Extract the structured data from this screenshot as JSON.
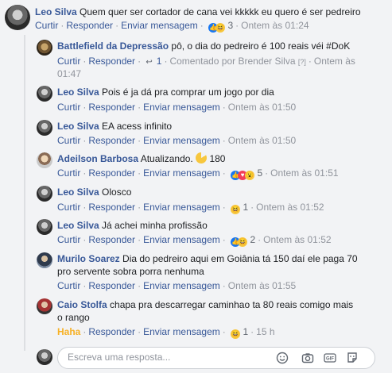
{
  "main": {
    "name": "Leo Silva",
    "text": "Quem quer ser cortador de cana vei kkkkk eu quero é ser pedreiro",
    "actions": {
      "curtir": "Curtir",
      "responder": "Responder",
      "enviar": "Enviar mensagem",
      "count": "3",
      "time": "Ontem às 01:24"
    }
  },
  "replies": [
    {
      "name": "Battlefield da Depressão",
      "text": "pô, o dia do pedreiro é 100 reais véi #DoK",
      "curtir": "Curtir",
      "responder": "Responder",
      "count": "1",
      "commented": "Comentado por Brender Silva",
      "commented_tag": "[?]",
      "time1": "Ontem às",
      "time2": "01:47"
    },
    {
      "name": "Leo Silva",
      "text": "Pois é ja dá pra comprar um jogo por dia",
      "curtir": "Curtir",
      "responder": "Responder",
      "enviar": "Enviar mensagem",
      "time": "Ontem às 01:50"
    },
    {
      "name": "Leo Silva",
      "text": "EA acess infinito",
      "curtir": "Curtir",
      "responder": "Responder",
      "enviar": "Enviar mensagem",
      "time": "Ontem às 01:50"
    },
    {
      "name": "Adeilson Barbosa",
      "text": "Atualizando.",
      "count_inline": "180",
      "curtir": "Curtir",
      "responder": "Responder",
      "enviar": "Enviar mensagem",
      "count": "5",
      "time": "Ontem às 01:51"
    },
    {
      "name": "Leo Silva",
      "text": "Olosco",
      "curtir": "Curtir",
      "responder": "Responder",
      "enviar": "Enviar mensagem",
      "count": "1",
      "time": "Ontem às 01:52"
    },
    {
      "name": "Leo Silva",
      "text": "Já achei minha profissão",
      "curtir": "Curtir",
      "responder": "Responder",
      "enviar": "Enviar mensagem",
      "count": "2",
      "time": "Ontem às 01:52"
    },
    {
      "name": "Murilo Soarez",
      "text1": "Dia do pedreiro aqui em Goiânia tá 150 daí ele paga 70",
      "text2": "pro servente sobra porra nenhuma",
      "curtir": "Curtir",
      "responder": "Responder",
      "enviar": "Enviar mensagem",
      "time": "Ontem às 01:55"
    },
    {
      "name": "Caio Stolfa",
      "text1": "chapa pra descarregar caminhao ta 80 reais comigo mais",
      "text2": "o rango",
      "haha": "Haha",
      "responder": "Responder",
      "enviar": "Enviar mensagem",
      "count": "1",
      "time": "15 h"
    }
  ],
  "composer": {
    "placeholder": "Escreva uma resposta..."
  },
  "icons": {
    "like": "like-icon",
    "haha": "haha-icon",
    "love": "love-icon",
    "wow": "wow-icon"
  },
  "colors": {
    "link": "#385898",
    "muted": "#90949c",
    "background": "#f2f3f5",
    "haha": "#f7b125"
  }
}
